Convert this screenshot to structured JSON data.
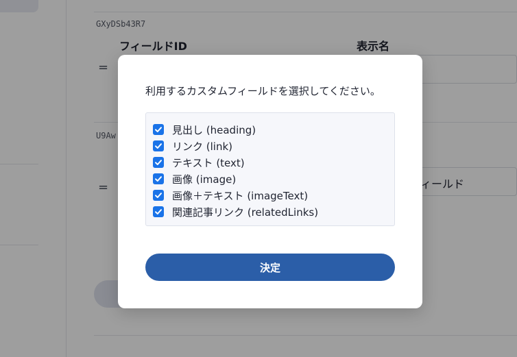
{
  "background": {
    "entries": [
      {
        "id": "GXyDSb43R7",
        "header_field_id": "フィールドID",
        "header_display_name": "表示名",
        "handle_icon": "drag-handle-icon",
        "display_name_value": ""
      },
      {
        "id": "U9Aw",
        "handle_icon": "drag-handle-icon",
        "display_name_value": "ィールド"
      }
    ]
  },
  "modal": {
    "title": "利用するカスタムフィールドを選択してください。",
    "fields": [
      {
        "label": "見出し (heading)",
        "checked": true
      },
      {
        "label": "リンク (link)",
        "checked": true
      },
      {
        "label": "テキスト (text)",
        "checked": true
      },
      {
        "label": "画像 (image)",
        "checked": true
      },
      {
        "label": "画像＋テキスト (imageText)",
        "checked": true
      },
      {
        "label": "関連記事リンク (relatedLinks)",
        "checked": true
      }
    ],
    "submit_label": "決定"
  },
  "colors": {
    "accent": "#2b5ea8",
    "checkbox": "#1a73e8",
    "list_background": "#f6f7fb"
  }
}
